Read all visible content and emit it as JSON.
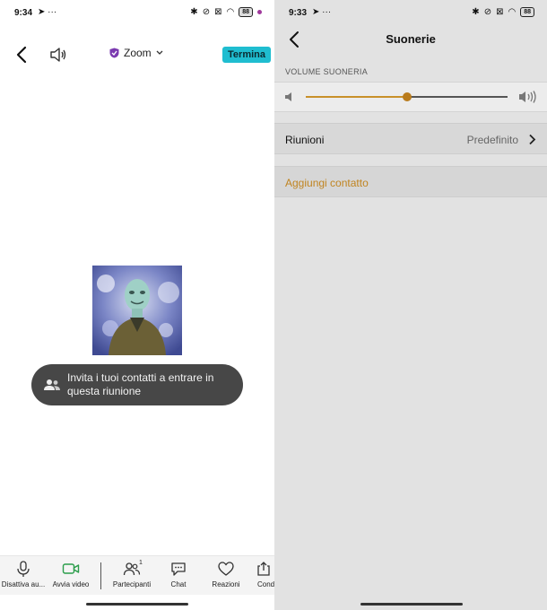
{
  "left": {
    "status": {
      "time": "9:34",
      "battery": "88"
    },
    "header": {
      "title": "Zoom",
      "end_label": "Termina"
    },
    "toast": {
      "text_line1": "Invita i tuoi contatti a entrare in",
      "text_line2": "questa riunione"
    },
    "toolbar": {
      "mute_label": "Disattiva au...",
      "video_label": "Avvia video",
      "participants_label": "Partecipanti",
      "participants_count": "1",
      "chat_label": "Chat",
      "reactions_label": "Reazioni",
      "share_label": "Cond"
    }
  },
  "right": {
    "status": {
      "time": "9:33",
      "battery": "88"
    },
    "header": {
      "title": "Suonerie"
    },
    "volume": {
      "section_label": "VOLUME SUONERIA",
      "level_percent": 50
    },
    "meetings": {
      "label": "Riunioni",
      "value": "Predefinito"
    },
    "add_contact": {
      "label": "Aggiungi contatto"
    }
  },
  "colors": {
    "accent_zoom": "#1fbdd0",
    "slider_accent": "#c8902a",
    "add_contact": "#c08420"
  },
  "icons": [
    "back-icon",
    "speaker-icon",
    "shield-icon",
    "chevron-down-icon",
    "people-icon",
    "microphone-icon",
    "video-camera-icon",
    "participants-icon",
    "chat-icon",
    "heart-icon",
    "share-icon",
    "volume-low-icon",
    "volume-high-icon",
    "chevron-right-icon"
  ]
}
